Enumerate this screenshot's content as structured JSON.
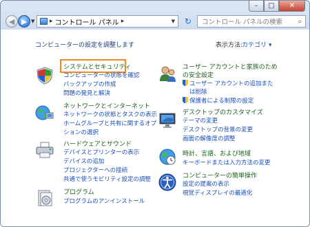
{
  "titlebar": {
    "buttons": [
      {
        "name": "minimize-button",
        "glyph": "–"
      },
      {
        "name": "maximize-button",
        "glyph": "□"
      },
      {
        "name": "close-button",
        "glyph": "✕"
      }
    ]
  },
  "nav": {
    "back_glyph": "◀",
    "forward_glyph": "▶",
    "history_glyph": "▼",
    "breadcrumb_sep1": "▸",
    "breadcrumb": "コントロール パネル",
    "breadcrumb_sep2": "▸",
    "address_drop": "▼",
    "refresh_glyph": "↻",
    "search_placeholder": "コントロール パネルの検索",
    "search_icon": "⌕"
  },
  "header": {
    "adjust_text": "コンピューターの設定を調整します",
    "view_label": "表示方法:",
    "view_value": "カテゴリ ▾"
  },
  "categories": [
    {
      "title": "システムとセキュリティ",
      "links": [
        "コンピューターの状態を確認",
        "バックアップの作成",
        "問題の発見と解決"
      ]
    },
    {
      "title": "ネットワークとインターネット",
      "links": [
        "ネットワークの状態とタスクの表示",
        "ホームグループと共有に関するオプ",
        "ションの選択"
      ]
    },
    {
      "title": "ハードウェアとサウンド",
      "links": [
        "デバイスとプリンターの表示",
        "デバイスの追加",
        "プロジェクターへの接続",
        "共通で使うモビリティ設定の調整"
      ]
    },
    {
      "title": "プログラム",
      "links": [
        "プログラムのアンインストール"
      ]
    },
    {
      "title": "ユーザー アカウントと家族のため",
      "title2": "の安全設定",
      "links": [
        "ユーザー アカウントの追加また",
        "は削除",
        "保護者による制限の設定"
      ]
    },
    {
      "title": "デスクトップのカスタマイズ",
      "links": [
        "テーマの変更",
        "デスクトップの背景の変更",
        "画面の解像度の調整"
      ]
    },
    {
      "title": "時計、言語、および地域",
      "links": [
        "キーボードまたは入力方法の変更"
      ]
    },
    {
      "title": "コンピューターの簡単操作",
      "links": [
        "設定の提案の表示",
        "視覚ディスプレイの最適化"
      ]
    }
  ],
  "colors": {
    "highlight": "#f28a1c",
    "title": "#1a5e1a",
    "link": "#1a4dbb"
  }
}
